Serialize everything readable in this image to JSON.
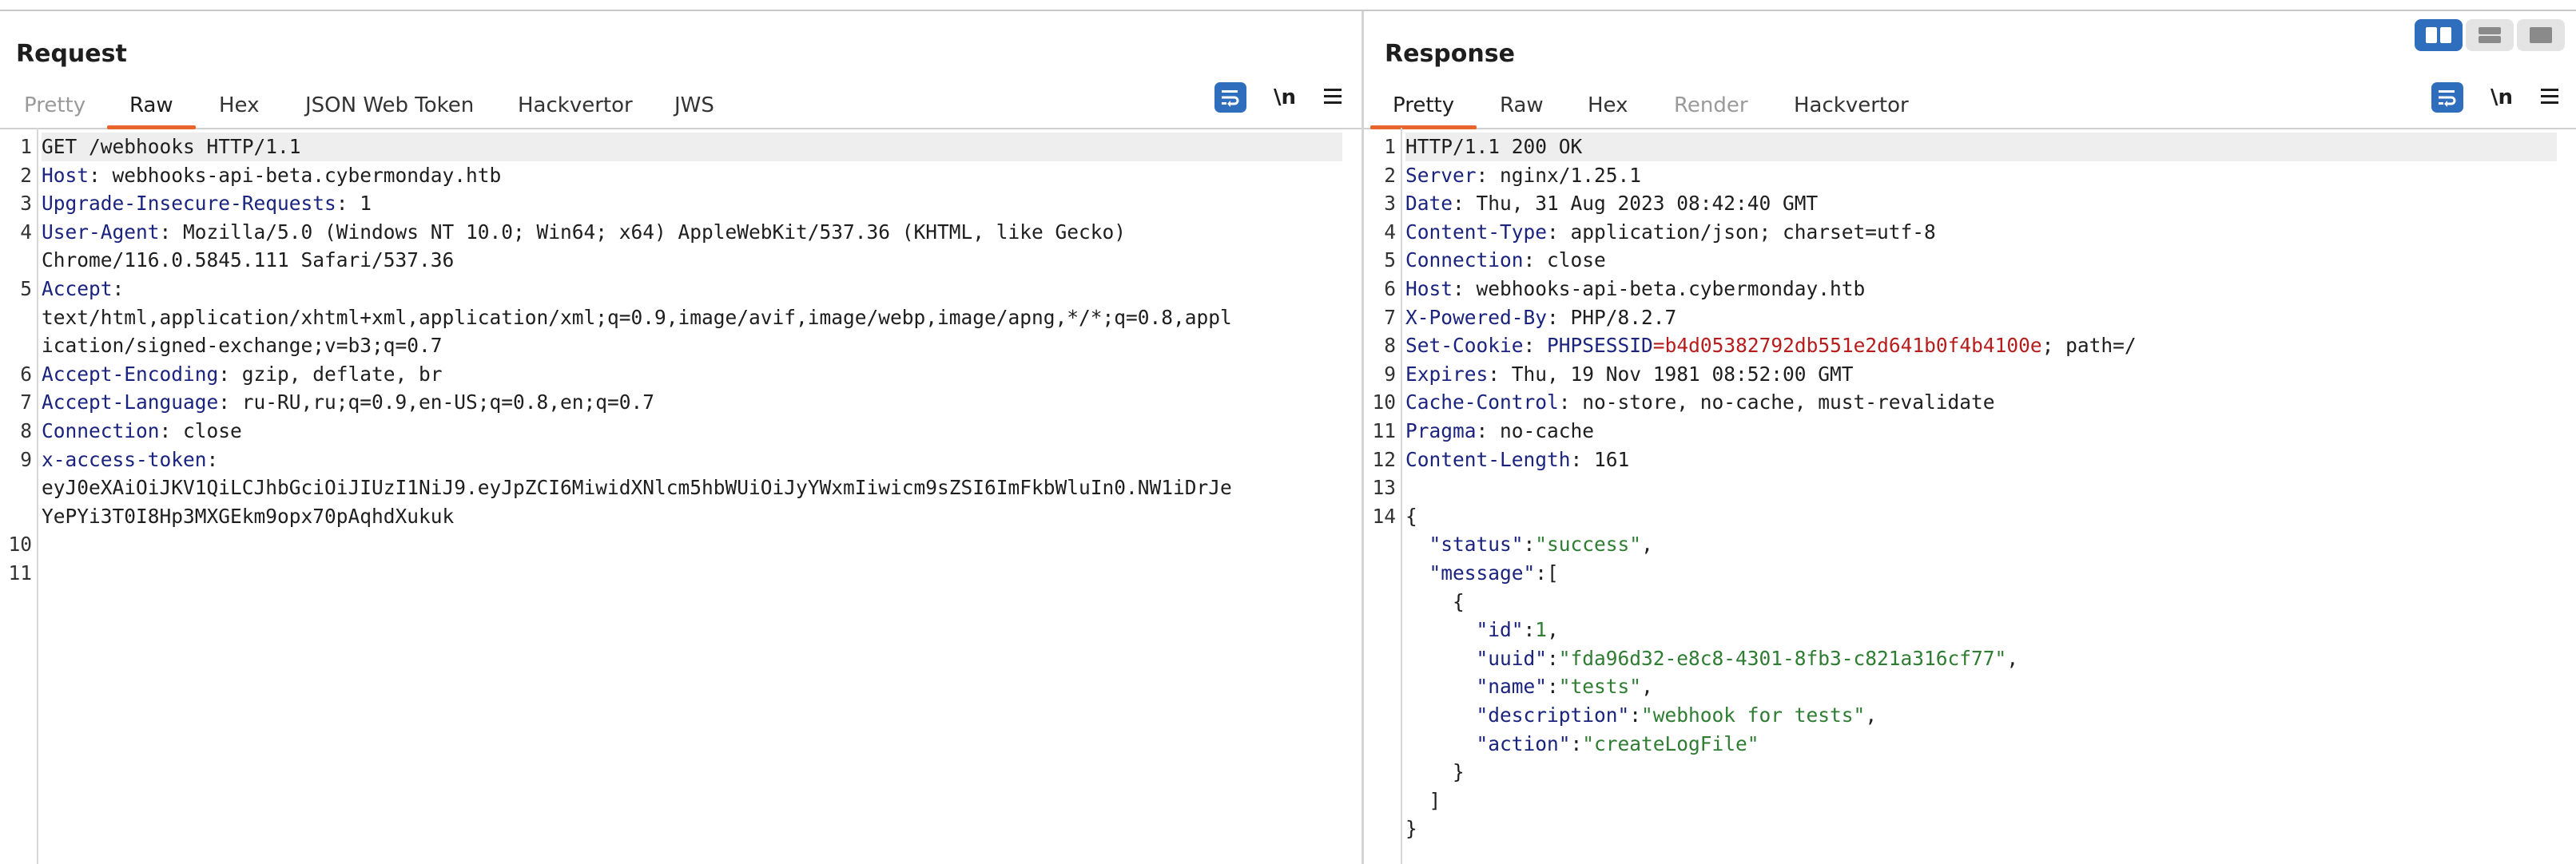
{
  "layout_buttons": [
    "split-horizontal-icon",
    "split-vertical-icon",
    "single-pane-icon"
  ],
  "request": {
    "title": "Request",
    "tabs": [
      "Pretty",
      "Raw",
      "Hex",
      "JSON Web Token",
      "Hackvertor",
      "JWS"
    ],
    "active_tab": "Raw",
    "newline_label": "\\n",
    "lines": [
      {
        "n": "1",
        "request_line": "GET /webhooks HTTP/1.1"
      },
      {
        "n": "2",
        "key": "Host",
        "sep": ": ",
        "value": "webhooks-api-beta.cybermonday.htb"
      },
      {
        "n": "3",
        "key": "Upgrade-Insecure-Requests",
        "sep": ": ",
        "value": "1"
      },
      {
        "n": "4",
        "key": "User-Agent",
        "sep": ": ",
        "value": "Mozilla/5.0 (Windows NT 10.0; Win64; x64) AppleWebKit/537.36 (KHTML, like Gecko)"
      },
      {
        "n": "",
        "cont": "Chrome/116.0.5845.111 Safari/537.36"
      },
      {
        "n": "5",
        "key": "Accept",
        "sep": ":",
        "value": ""
      },
      {
        "n": "",
        "cont": "text/html,application/xhtml+xml,application/xml;q=0.9,image/avif,image/webp,image/apng,*/*;q=0.8,appl"
      },
      {
        "n": "",
        "cont": "ication/signed-exchange;v=b3;q=0.7"
      },
      {
        "n": "6",
        "key": "Accept-Encoding",
        "sep": ": ",
        "value": "gzip, deflate, br"
      },
      {
        "n": "7",
        "key": "Accept-Language",
        "sep": ": ",
        "value": "ru-RU,ru;q=0.9,en-US;q=0.8,en;q=0.7"
      },
      {
        "n": "8",
        "key": "Connection",
        "sep": ": ",
        "value": "close"
      },
      {
        "n": "9",
        "key": "x-access-token",
        "sep": ":",
        "value": ""
      },
      {
        "n": "",
        "cont": "eyJ0eXAiOiJKV1QiLCJhbGciOiJIUzI1NiJ9.eyJpZCI6MiwidXNlcm5hbWUiOiJyYWxmIiwicm9sZSI6ImFkbWluIn0.NW1iDrJe"
      },
      {
        "n": "",
        "cont": "YePYi3T0I8Hp3MXGEkm9opx70pAqhdXukuk"
      },
      {
        "n": "10",
        "cont": ""
      },
      {
        "n": "11",
        "cont": ""
      }
    ]
  },
  "response": {
    "title": "Response",
    "tabs": [
      "Pretty",
      "Raw",
      "Hex",
      "Render",
      "Hackvertor"
    ],
    "active_tab": "Pretty",
    "disabled_tab": "Render",
    "newline_label": "\\n",
    "lines": [
      {
        "n": "1",
        "status_line": "HTTP/1.1 200 OK"
      },
      {
        "n": "2",
        "key": "Server",
        "sep": ": ",
        "value": "nginx/1.25.1"
      },
      {
        "n": "3",
        "key": "Date",
        "sep": ": ",
        "value": "Thu, 31 Aug 2023 08:42:40 GMT"
      },
      {
        "n": "4",
        "key": "Content-Type",
        "sep": ": ",
        "value": "application/json; charset=utf-8"
      },
      {
        "n": "5",
        "key": "Connection",
        "sep": ": ",
        "value": "close"
      },
      {
        "n": "6",
        "key": "Host",
        "sep": ": ",
        "value": "webhooks-api-beta.cybermonday.htb"
      },
      {
        "n": "7",
        "key": "X-Powered-By",
        "sep": ": ",
        "value": "PHP/8.2.7"
      },
      {
        "n": "8",
        "key": "Set-Cookie",
        "sep": ": ",
        "cookie_name": "PHPSESSID",
        "cookie_eq": "=",
        "cookie_value": "b4d05382792db551e2d641b0f4b4100e",
        "cookie_rest": "; path=/"
      },
      {
        "n": "9",
        "key": "Expires",
        "sep": ": ",
        "value": "Thu, 19 Nov 1981 08:52:00 GMT"
      },
      {
        "n": "10",
        "key": "Cache-Control",
        "sep": ": ",
        "value": "no-store, no-cache, must-revalidate"
      },
      {
        "n": "11",
        "key": "Pragma",
        "sep": ": ",
        "value": "no-cache"
      },
      {
        "n": "12",
        "key": "Content-Length",
        "sep": ": ",
        "value": "161"
      },
      {
        "n": "13",
        "cont": ""
      },
      {
        "n": "14",
        "cont": "{"
      },
      {
        "n": "",
        "indent": "  ",
        "jkey": "\"status\"",
        "jsep": ":",
        "jval": "\"success\"",
        "jtail": ","
      },
      {
        "n": "",
        "indent": "  ",
        "jkey": "\"message\"",
        "jsep": ":",
        "jval": "",
        "jtail": "["
      },
      {
        "n": "",
        "cont": "    {"
      },
      {
        "n": "",
        "indent": "      ",
        "jkey": "\"id\"",
        "jsep": ":",
        "jval": "1",
        "jtail": ","
      },
      {
        "n": "",
        "indent": "      ",
        "jkey": "\"uuid\"",
        "jsep": ":",
        "jval": "\"fda96d32-e8c8-4301-8fb3-c821a316cf77\"",
        "jtail": ","
      },
      {
        "n": "",
        "indent": "      ",
        "jkey": "\"name\"",
        "jsep": ":",
        "jval": "\"tests\"",
        "jtail": ","
      },
      {
        "n": "",
        "indent": "      ",
        "jkey": "\"description\"",
        "jsep": ":",
        "jval": "\"webhook for tests\"",
        "jtail": ","
      },
      {
        "n": "",
        "indent": "      ",
        "jkey": "\"action\"",
        "jsep": ":",
        "jval": "\"createLogFile\"",
        "jtail": ""
      },
      {
        "n": "",
        "cont": "    }"
      },
      {
        "n": "",
        "cont": "  ]"
      },
      {
        "n": "",
        "cont": "}"
      }
    ]
  }
}
